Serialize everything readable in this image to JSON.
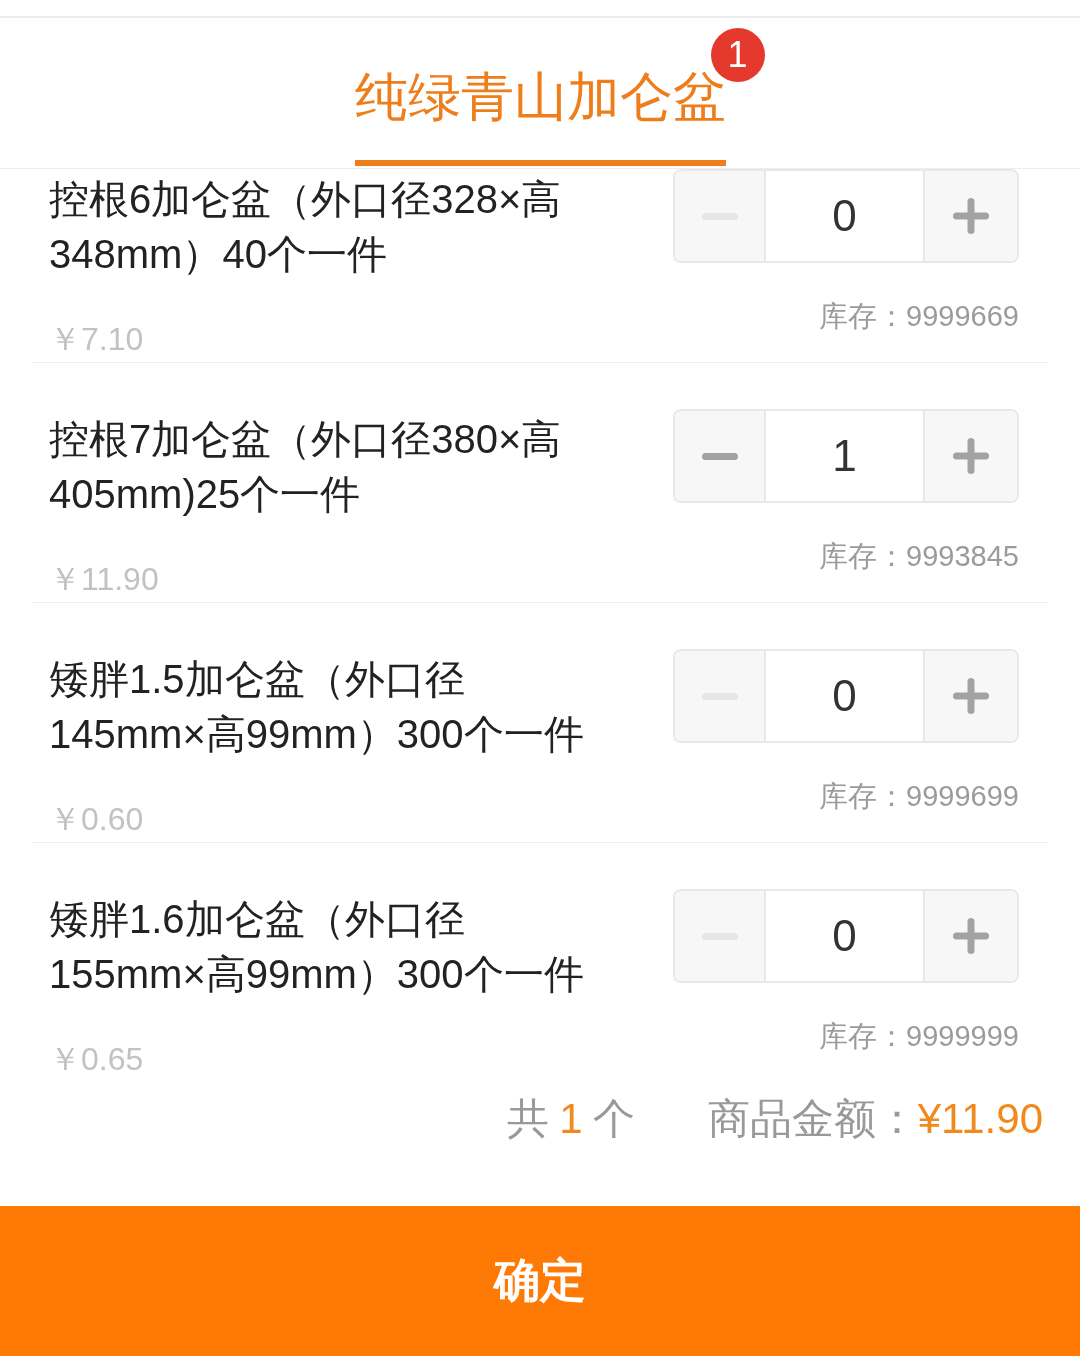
{
  "tabs": [
    {
      "label": "纯绿青山加仑盆",
      "badge": "1",
      "selected": true
    }
  ],
  "items": [
    {
      "title": "控根6加仑盆（外口径328×高348mm）40个一件",
      "price": "￥7.10",
      "quantity": "0",
      "decrement_disabled": true,
      "stock": "库存：9999669"
    },
    {
      "title": "控根7加仑盆（外口径380×高405mm)25个一件",
      "price": "￥11.90",
      "quantity": "1",
      "decrement_disabled": false,
      "stock": "库存：9993845"
    },
    {
      "title": "矮胖1.5加仑盆（外口径145mm×高99mm）300个一件",
      "price": "￥0.60",
      "quantity": "0",
      "decrement_disabled": true,
      "stock": "库存：9999699"
    },
    {
      "title": "矮胖1.6加仑盆（外口径155mm×高99mm）300个一件",
      "price": "￥0.65",
      "quantity": "0",
      "decrement_disabled": true,
      "stock": "库存：9999999"
    }
  ],
  "summary": {
    "count_prefix": "共",
    "count": "1",
    "count_suffix": "个",
    "amount_label": "商品金额：",
    "amount": "¥11.90"
  },
  "confirm_button": "确定"
}
